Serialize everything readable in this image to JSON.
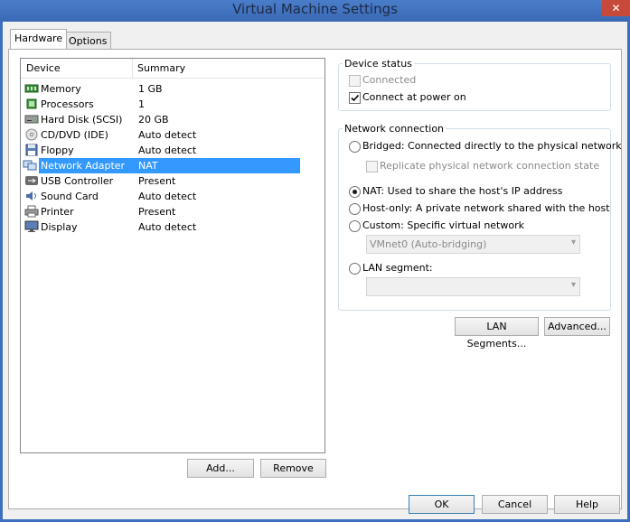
{
  "window": {
    "title": "Virtual Machine Settings",
    "close": "✕"
  },
  "tabs": [
    {
      "label": "Hardware"
    },
    {
      "label": "Options"
    }
  ],
  "device_list": {
    "headers": {
      "device": "Device",
      "summary": "Summary"
    },
    "rows": [
      {
        "name": "Memory",
        "summary": "1 GB",
        "icon": "memory-icon"
      },
      {
        "name": "Processors",
        "summary": "1",
        "icon": "processor-icon"
      },
      {
        "name": "Hard Disk (SCSI)",
        "summary": "20 GB",
        "icon": "hard-disk-icon"
      },
      {
        "name": "CD/DVD (IDE)",
        "summary": "Auto detect",
        "icon": "cd-dvd-icon"
      },
      {
        "name": "Floppy",
        "summary": "Auto detect",
        "icon": "floppy-icon"
      },
      {
        "name": "Network Adapter",
        "summary": "NAT",
        "icon": "network-adapter-icon",
        "selected": true
      },
      {
        "name": "USB Controller",
        "summary": "Present",
        "icon": "usb-icon"
      },
      {
        "name": "Sound Card",
        "summary": "Auto detect",
        "icon": "sound-card-icon"
      },
      {
        "name": "Printer",
        "summary": "Present",
        "icon": "printer-icon"
      },
      {
        "name": "Display",
        "summary": "Auto detect",
        "icon": "display-icon"
      }
    ],
    "add_button": "Add...",
    "remove_button": "Remove"
  },
  "device_status": {
    "label": "Device status",
    "connected": {
      "label": "Connected",
      "checked": false,
      "enabled": false
    },
    "connect_at_power_on": {
      "label": "Connect at power on",
      "checked": true
    }
  },
  "network_connection": {
    "label": "Network connection",
    "bridged": "Bridged: Connected directly to the physical network",
    "replicate": "Replicate physical network connection state",
    "nat": "NAT: Used to share the host's IP address",
    "host_only": "Host-only: A private network shared with the host",
    "custom": "Custom: Specific virtual network",
    "custom_select": "VMnet0 (Auto-bridging)",
    "lan_segment": "LAN segment:",
    "lan_select": "",
    "selected": "nat"
  },
  "right_buttons": {
    "lan_segments": "LAN Segments...",
    "advanced": "Advanced..."
  },
  "footer": {
    "ok": "OK",
    "cancel": "Cancel",
    "help": "Help"
  }
}
